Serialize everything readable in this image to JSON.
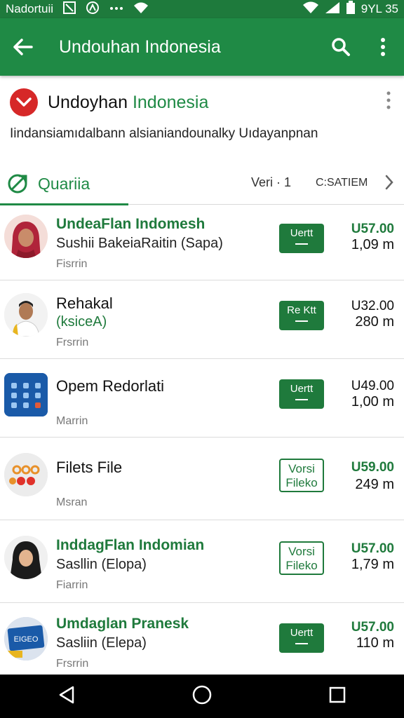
{
  "status": {
    "carrier": "Nadortuii",
    "time": "9YL 35"
  },
  "app_bar": {
    "title": "Undouhan Indonesia"
  },
  "header": {
    "name_part1": "Undoyhan",
    "name_part2": "Indonesia"
  },
  "description": "Iindansiamıdalbann alsianiandounalky Uıdayanpnan",
  "tabs": {
    "active": "Quariia",
    "ver": "Veri · 1",
    "sat": "C:SATIEM"
  },
  "items": [
    {
      "title": "UndeaFlan Indomesh",
      "subtitle": "Sushii BakeiaRaitin (Sapa)",
      "meta": "Fisrrin",
      "button": "Uertt",
      "price": "U57.00",
      "size": "1,09 m"
    },
    {
      "title": "Rehakal",
      "subtitle": "(ksiceA)",
      "meta": "Frsrrin",
      "button": "Re Ktt",
      "price": "U32.00",
      "size": "280 m"
    },
    {
      "title": "Opem Redorlati",
      "subtitle": "",
      "meta": "Marrin",
      "button": "Uertt",
      "price": "U49.00",
      "size": "1,00 m"
    },
    {
      "title": "Filets File",
      "subtitle": "",
      "meta": "Msran",
      "button_line1": "Vorsi",
      "button_line2": "Fileko",
      "price": "U59.00",
      "size": "249 m"
    },
    {
      "title": "InddagFlan Indomian",
      "subtitle": "Sasllin (Elopa)",
      "meta": "Fiarrin",
      "button_line1": "Vorsi",
      "button_line2": "Fileko",
      "price": "U57.00",
      "size": "1,79 m"
    },
    {
      "title": "Umdaglan Pranesk",
      "subtitle": "Sasliin (Elepa)",
      "meta": "Frsrrin",
      "button": "Uertt",
      "price": "U57.00",
      "size": "110 m",
      "thumb_text": "EIGEO"
    }
  ],
  "colors": {
    "primary": "#1f8a45",
    "dark_primary": "#1e7a3c",
    "accent_red": "#d62828"
  }
}
